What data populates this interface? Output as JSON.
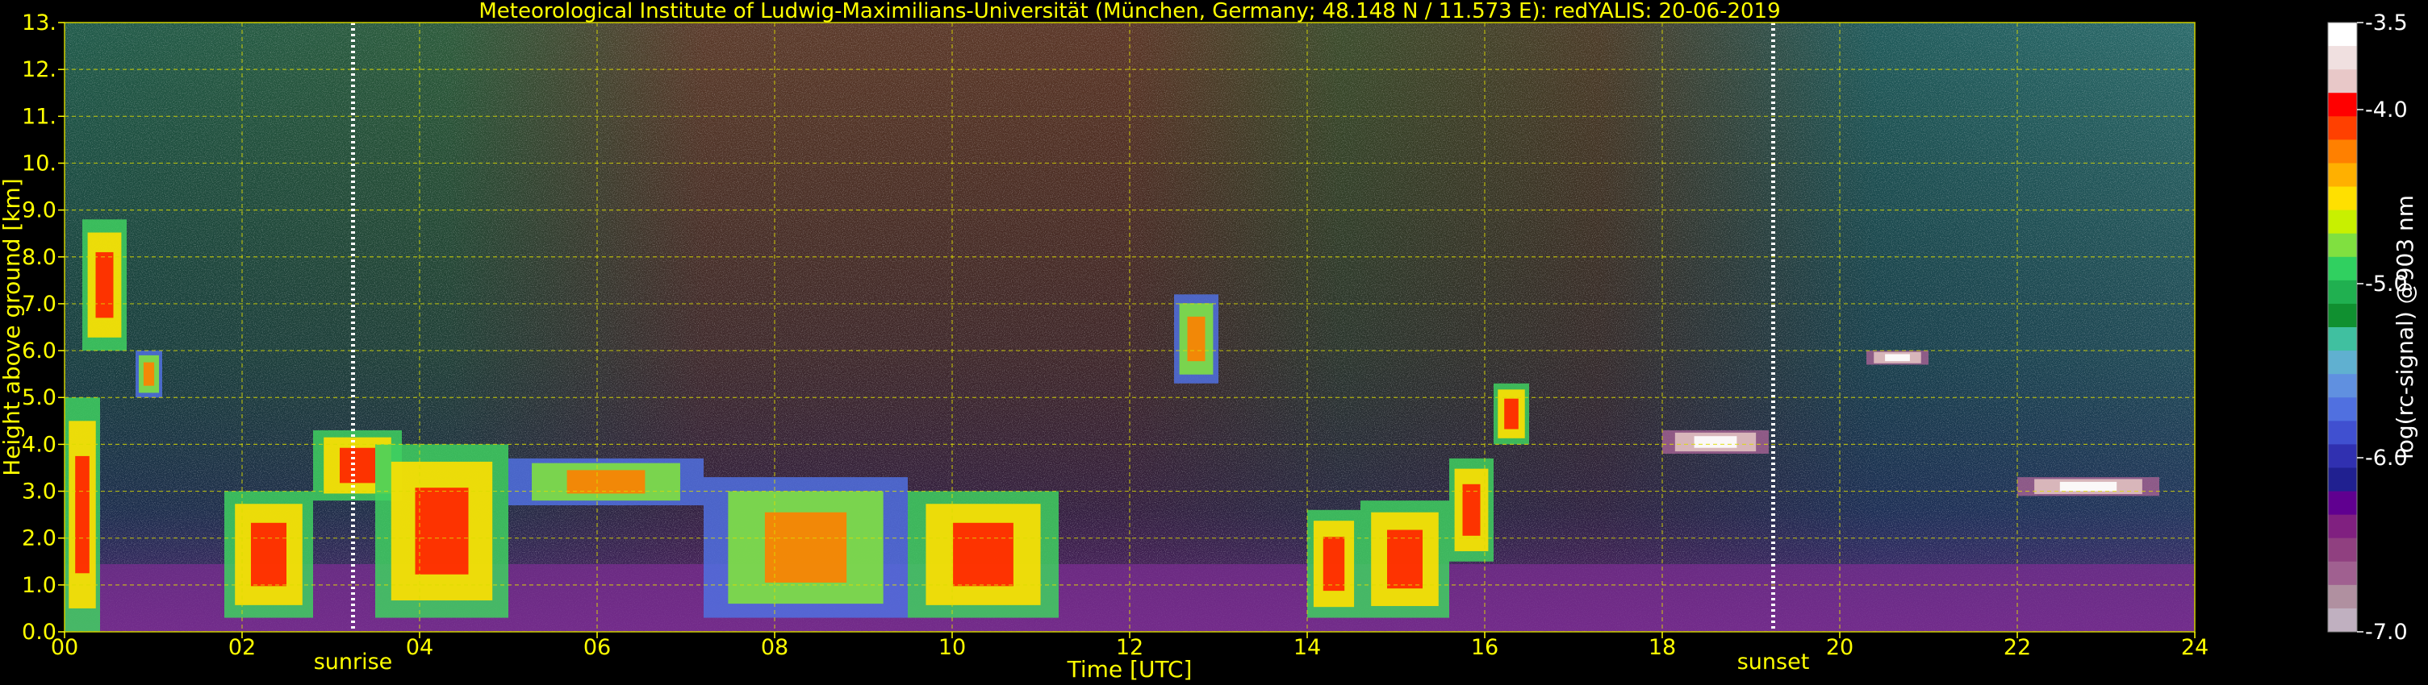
{
  "chart_data": {
    "type": "heatmap",
    "title": "Meteorological Institute of Ludwig-Maximilians-Universität (München, Germany; 48.148 N / 11.573 E):    redYALIS: 20-06-2019",
    "xlabel": "Time [UTC]",
    "ylabel": "Height above ground [km]",
    "xlim": [
      0,
      24
    ],
    "ylim": [
      0,
      13
    ],
    "x_ticks": [
      "00",
      "02",
      "04",
      "06",
      "08",
      "10",
      "12",
      "14",
      "16",
      "18",
      "20",
      "22",
      "24"
    ],
    "y_ticks": [
      "0.0",
      "1.0",
      "2.0",
      "3.0",
      "4.0",
      "5.0",
      "6.0",
      "7.0",
      "8.0",
      "9.0",
      "10.",
      "11.",
      "12.",
      "13."
    ],
    "grid": true,
    "events": [
      {
        "label": "sunrise",
        "time": 3.25
      },
      {
        "label": "sunset",
        "time": 19.25
      }
    ],
    "colorbar": {
      "label": "log(rc-signal) @903 nm",
      "range": [
        -7.0,
        -3.5
      ],
      "ticks": [
        "-3.5",
        "-4.0",
        "-5.0",
        "-6.0",
        "-7.0"
      ],
      "colors": [
        "#ffffff",
        "#f0e0e0",
        "#e8c8c8",
        "#ff0000",
        "#ff4000",
        "#ff8000",
        "#ffb000",
        "#ffe000",
        "#c8f000",
        "#80e040",
        "#30d060",
        "#20b050",
        "#109030",
        "#40c0a0",
        "#60b0d0",
        "#6090e0",
        "#5070e0",
        "#4050d0",
        "#3030b0",
        "#202090",
        "#600090",
        "#802080",
        "#904080",
        "#a06090",
        "#b090a0",
        "#c0b0c0"
      ]
    },
    "cloud_layers": [
      {
        "t0": 0.0,
        "t1": 0.4,
        "h0": 0.0,
        "h1": 5.0,
        "intensity": "high"
      },
      {
        "t0": 0.2,
        "t1": 0.7,
        "h0": 6.0,
        "h1": 8.8,
        "intensity": "high"
      },
      {
        "t0": 0.8,
        "t1": 1.1,
        "h0": 5.0,
        "h1": 6.0,
        "intensity": "medium"
      },
      {
        "t0": 1.8,
        "t1": 2.8,
        "h0": 0.3,
        "h1": 3.0,
        "intensity": "high"
      },
      {
        "t0": 2.8,
        "t1": 3.8,
        "h0": 2.8,
        "h1": 4.3,
        "intensity": "high"
      },
      {
        "t0": 3.5,
        "t1": 5.0,
        "h0": 0.3,
        "h1": 4.0,
        "intensity": "high"
      },
      {
        "t0": 5.0,
        "t1": 7.2,
        "h0": 2.7,
        "h1": 3.7,
        "intensity": "medium"
      },
      {
        "t0": 7.2,
        "t1": 9.5,
        "h0": 0.3,
        "h1": 3.3,
        "intensity": "medium"
      },
      {
        "t0": 9.5,
        "t1": 11.2,
        "h0": 0.3,
        "h1": 3.0,
        "intensity": "high"
      },
      {
        "t0": 12.5,
        "t1": 13.0,
        "h0": 5.3,
        "h1": 7.2,
        "intensity": "medium"
      },
      {
        "t0": 14.0,
        "t1": 14.6,
        "h0": 0.3,
        "h1": 2.6,
        "intensity": "high"
      },
      {
        "t0": 14.6,
        "t1": 15.6,
        "h0": 0.3,
        "h1": 2.8,
        "intensity": "high"
      },
      {
        "t0": 15.6,
        "t1": 16.1,
        "h0": 1.5,
        "h1": 3.7,
        "intensity": "high"
      },
      {
        "t0": 16.1,
        "t1": 16.5,
        "h0": 4.0,
        "h1": 5.3,
        "intensity": "high"
      },
      {
        "t0": 18.0,
        "t1": 19.2,
        "h0": 3.8,
        "h1": 4.3,
        "intensity": "low"
      },
      {
        "t0": 20.3,
        "t1": 21.0,
        "h0": 5.7,
        "h1": 6.0,
        "intensity": "low"
      },
      {
        "t0": 22.0,
        "t1": 23.6,
        "h0": 2.9,
        "h1": 3.3,
        "intensity": "low"
      }
    ]
  }
}
